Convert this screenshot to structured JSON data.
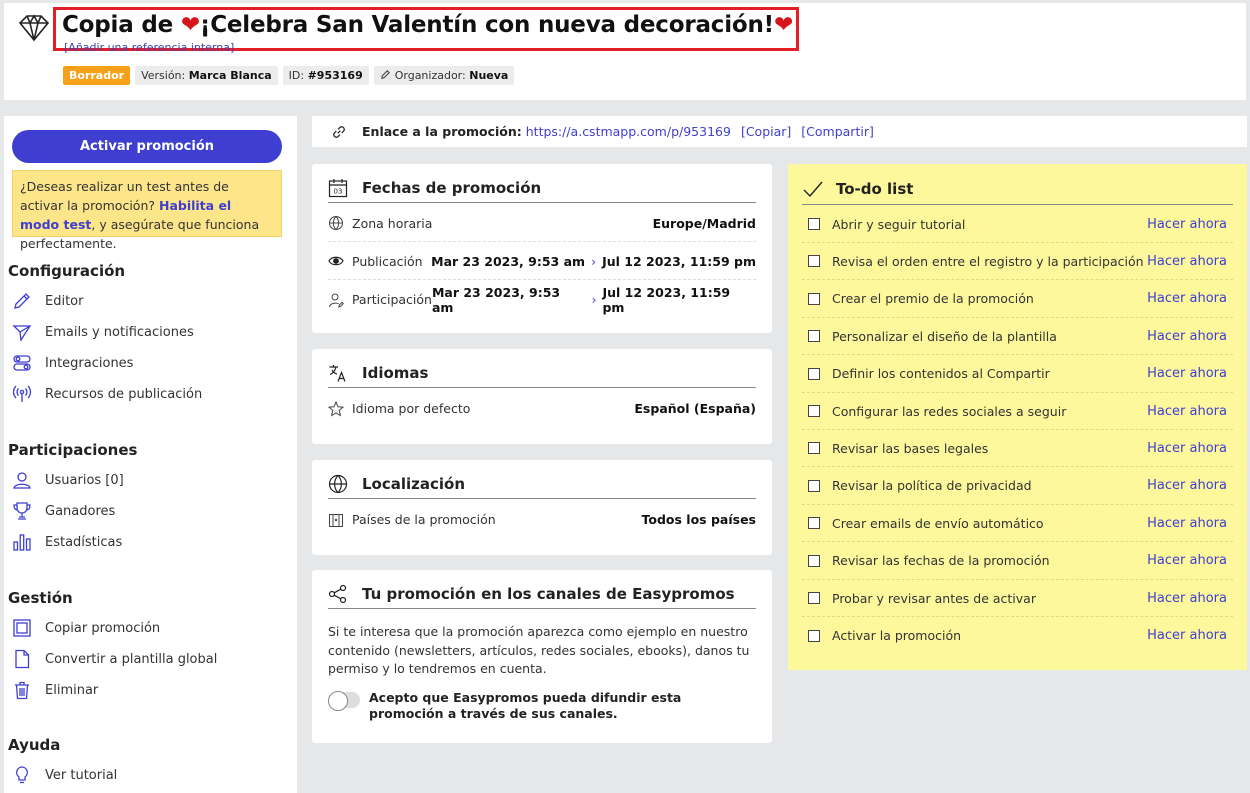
{
  "header": {
    "title_prefix": "Copia de ",
    "heart": "❤",
    "title_main": "¡Celebra San Valentín con nueva decoración!",
    "internal_ref": "[Añadir una referencia interna]",
    "badges": {
      "status": "Borrador",
      "version_label": "Versión:",
      "version_value": "Marca Blanca",
      "id_label": "ID:",
      "id_value": "#953169",
      "organizer_label": "Organizador:",
      "organizer_value": "Nueva"
    }
  },
  "sidebar": {
    "activate_label": "Activar promoción",
    "test_note": {
      "before": "¿Deseas realizar un test antes de activar la promoción? ",
      "link": "Habilita el modo test",
      "after": ", y asegúrate que funciona perfectamente."
    },
    "sections": {
      "config": "Configuración",
      "participations": "Participaciones",
      "management": "Gestión",
      "help": "Ayuda"
    },
    "items": {
      "editor": "Editor",
      "emails": "Emails y notificaciones",
      "integrations": "Integraciones",
      "resources": "Recursos de publicación",
      "users": "Usuarios [0]",
      "winners": "Ganadores",
      "stats": "Estadísticas",
      "copy": "Copiar promoción",
      "template": "Convertir a plantilla global",
      "delete": "Eliminar",
      "tutorial": "Ver tutorial"
    }
  },
  "linkbar": {
    "label": "Enlace a la promoción:",
    "url": "https://a.cstmapp.com/p/953169",
    "copy": "[Copiar]",
    "share": "[Compartir]"
  },
  "dates": {
    "title": "Fechas de promoción",
    "calendar_num": "03",
    "timezone_label": "Zona horaria",
    "timezone_value": "Europe/Madrid",
    "publication_label": "Publicación",
    "publication_start": "Mar 23 2023, 9:53 am",
    "publication_end": "Jul 12 2023, 11:59 pm",
    "participation_label": "Participación",
    "participation_start": "Mar 23 2023, 9:53 am",
    "participation_end": "Jul 12 2023, 11:59 pm",
    "chevron": "›"
  },
  "languages": {
    "title": "Idiomas",
    "default_label": "Idioma por defecto",
    "default_value": "Español (España)"
  },
  "localization": {
    "title": "Localización",
    "countries_label": "Países de la promoción",
    "countries_value": "Todos los países"
  },
  "channels": {
    "title": "Tu promoción en los canales de Easypromos",
    "text": "Si te interesa que la promoción aparezca como ejemplo en nuestro contenido (newsletters, artículos, redes sociales, ebooks), danos tu permiso y lo tendremos en cuenta.",
    "toggle_label": "Acepto que Easypromos pueda difundir esta promoción a través de sus canales.",
    "toggle_on": false
  },
  "todo": {
    "title": "To-do list",
    "action": "Hacer ahora",
    "items": [
      "Abrir y seguir tutorial",
      "Revisa el orden entre el registro y la participación",
      "Crear el premio de la promoción",
      "Personalizar el diseño de la plantilla",
      "Definir los contenidos al Compartir",
      "Configurar las redes sociales a seguir",
      "Revisar las bases legales",
      "Revisar la política de privacidad",
      "Crear emails de envío automático",
      "Revisar las fechas de la promoción",
      "Probar y revisar antes de activar",
      "Activar la promoción"
    ]
  },
  "colors": {
    "accent": "#3e3fd0",
    "draft": "#f6a119",
    "todo_bg": "#fdf89c",
    "highlight": "#e41e26"
  }
}
